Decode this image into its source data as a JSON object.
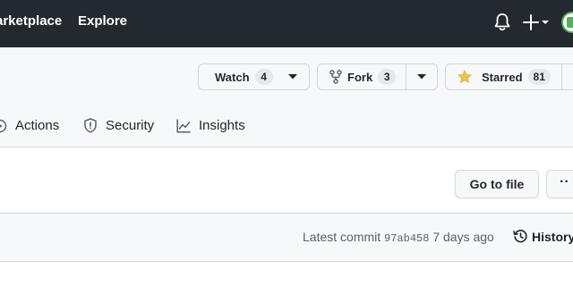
{
  "topnav": {
    "items": [
      "arketplace",
      "Explore"
    ]
  },
  "repo_actions": {
    "watch": {
      "label": "Watch",
      "count": "4"
    },
    "fork": {
      "label": "Fork",
      "count": "3"
    },
    "star": {
      "label": "Starred",
      "count": "81"
    }
  },
  "tabs": [
    {
      "label": "Actions",
      "icon": "play-icon"
    },
    {
      "label": "Security",
      "icon": "shield-icon"
    },
    {
      "label": "Insights",
      "icon": "graph-icon"
    }
  ],
  "file_nav": {
    "go_to_file": "Go to file",
    "more": "··"
  },
  "latest_commit": {
    "prefix": "Latest commit",
    "sha": "97ab458",
    "age": "7 days ago",
    "history_label": "History"
  },
  "colors": {
    "header_bg": "#24292f",
    "star_fill": "#eac54f",
    "subtle_bg": "#f6f8fa",
    "border": "#d0d7de"
  }
}
